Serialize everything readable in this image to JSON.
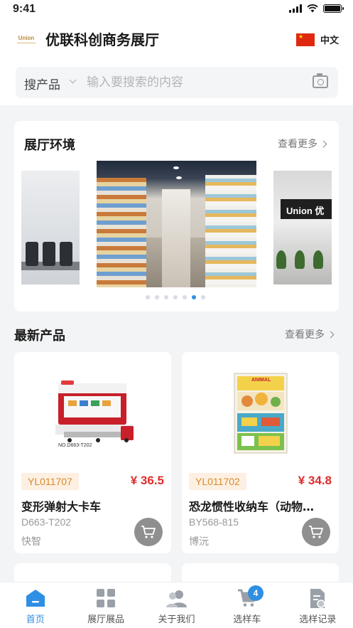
{
  "status_bar": {
    "time": "9:41"
  },
  "header": {
    "logo_text": "Union",
    "title": "优联科创商务展厅",
    "language": {
      "label": "中文",
      "flag": "china-flag-icon"
    }
  },
  "search": {
    "type_label": "搜产品",
    "placeholder": "输入要搜索的内容",
    "value": ""
  },
  "showroom": {
    "title": "展厅环境",
    "more_label": "查看更多",
    "slides": [
      {
        "name": "meeting-room",
        "sign": ""
      },
      {
        "name": "showroom-aisle",
        "sign": ""
      },
      {
        "name": "showroom-reception",
        "sign": "Union 优"
      }
    ],
    "pager": {
      "total": 7,
      "active_index": 5
    }
  },
  "new_products": {
    "title": "最新产品",
    "more_label": "查看更多",
    "items": [
      {
        "code": "YL011707",
        "price": "¥ 36.5",
        "name": "变形弹射大卡车",
        "model": "D663-T202",
        "brand": "快智",
        "image_label": "NO.D663-T202"
      },
      {
        "code": "YL011702",
        "price": "¥ 34.8",
        "name": "恐龙惯性收纳车（动物…",
        "model": "BY568-815",
        "brand": "博沅",
        "image_label": "ANIMAL"
      }
    ]
  },
  "tab_bar": {
    "tabs": [
      {
        "label": "首页",
        "icon": "home-icon",
        "active": true
      },
      {
        "label": "展厅展品",
        "icon": "grid-icon",
        "active": false
      },
      {
        "label": "关于我们",
        "icon": "users-icon",
        "active": false
      },
      {
        "label": "选样车",
        "icon": "cart-icon",
        "active": false,
        "badge": "4"
      },
      {
        "label": "选样记录",
        "icon": "record-icon",
        "active": false
      }
    ]
  },
  "colors": {
    "accent": "#2f8fe3",
    "price": "#e12c2c",
    "code_badge_bg": "#fdf0e2",
    "code_badge_text": "#d98a2c",
    "cart_button": "#8f8f8f"
  }
}
